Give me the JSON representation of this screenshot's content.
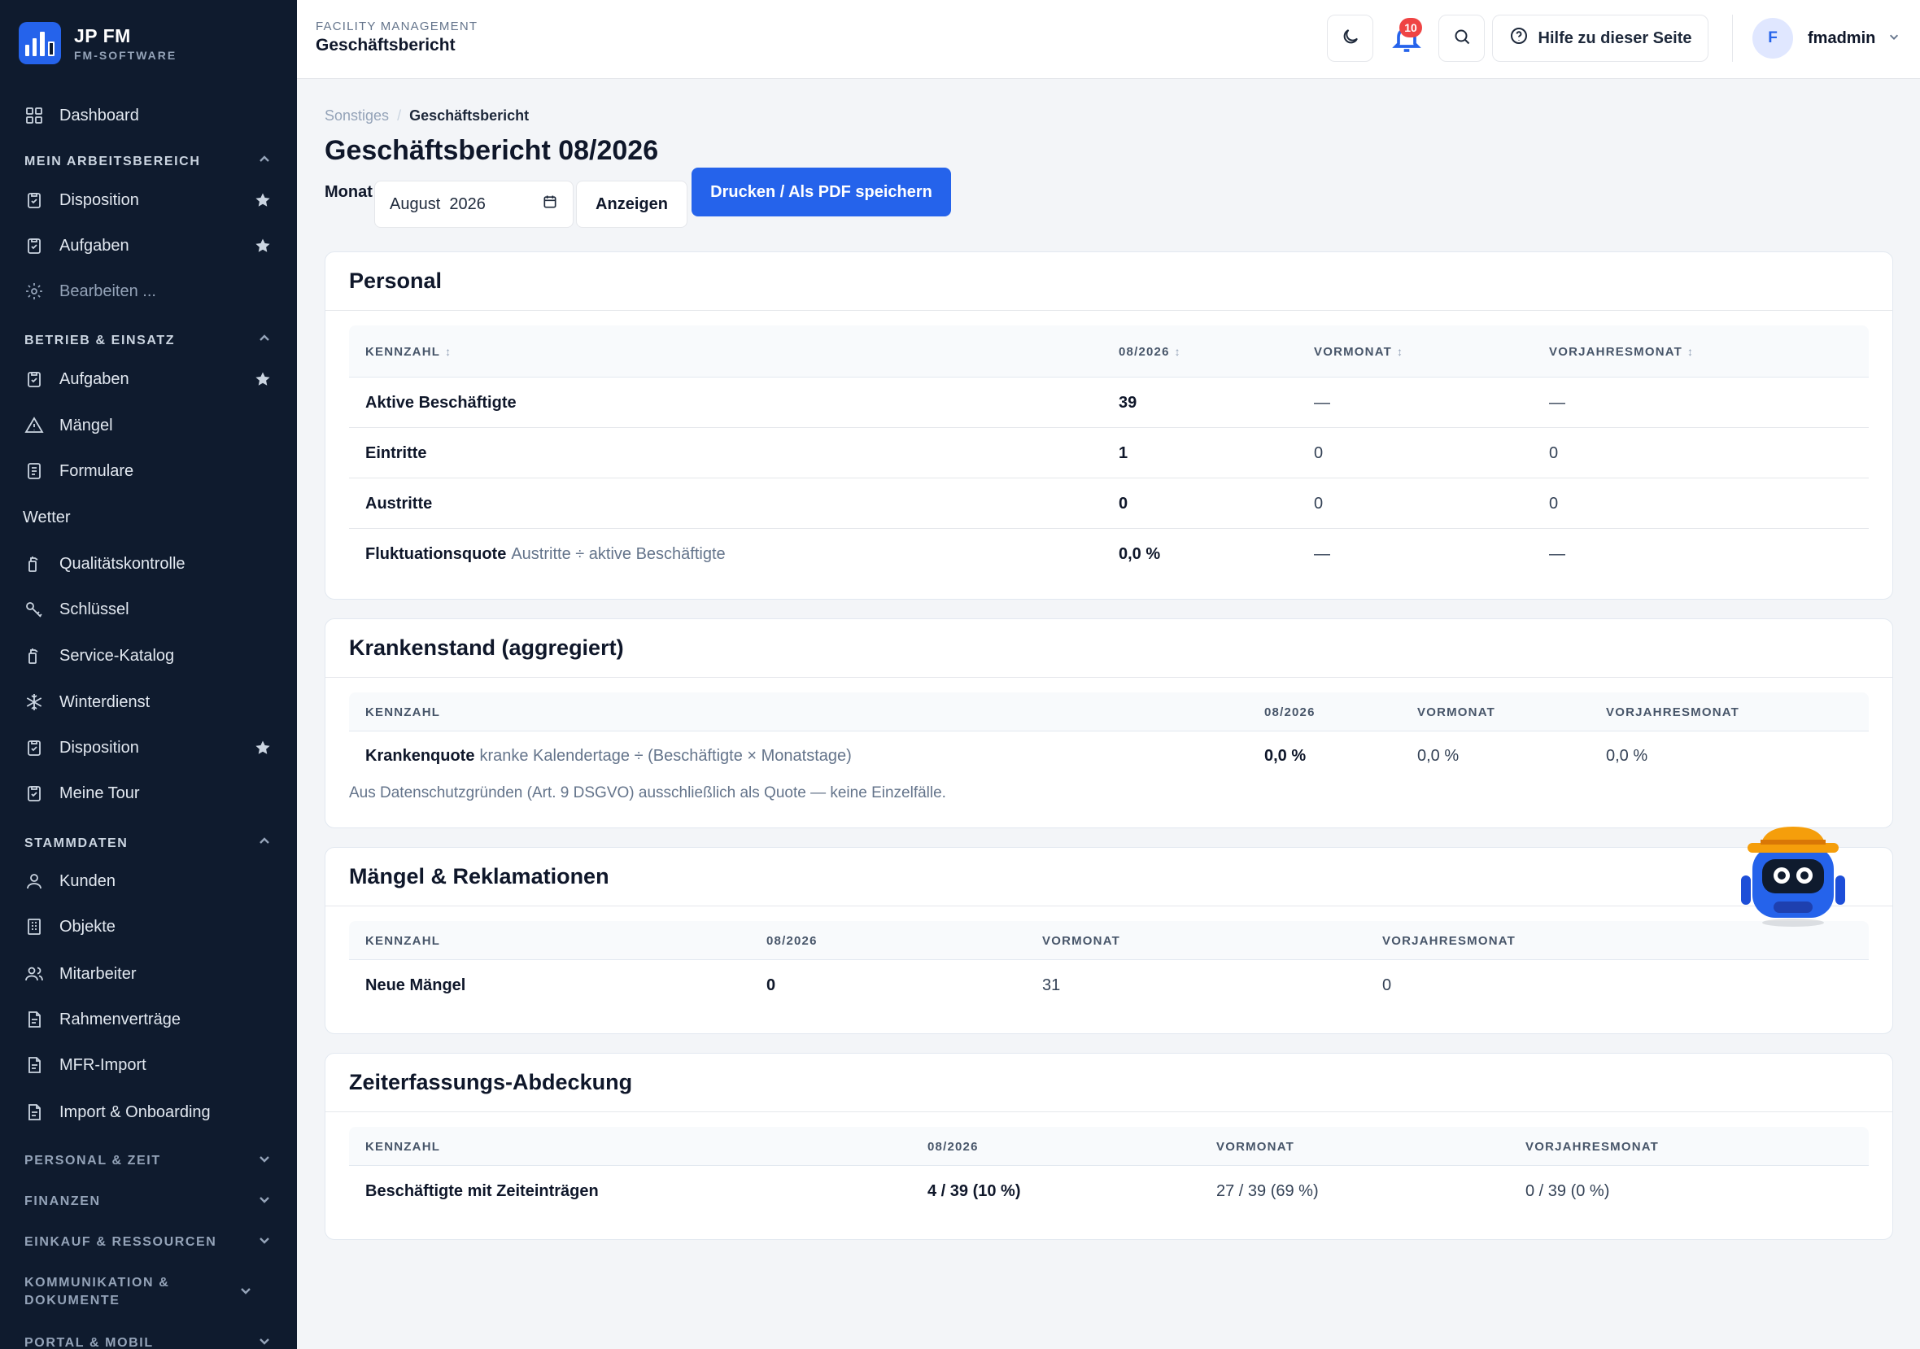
{
  "brand": {
    "title": "JP FM",
    "subtitle": "FM-SOFTWARE"
  },
  "sidebar": {
    "dashboard": "Dashboard",
    "sections": {
      "work": "MEIN ARBEITSBEREICH",
      "ops": "BETRIEB & EINSATZ",
      "master": "STAMMDATEN",
      "personal": "PERSONAL & ZEIT",
      "finance": "FINANZEN",
      "purchase": "EINKAUF & RESSOURCEN",
      "comm": "KOMMUNIKATION & DOKUMENTE",
      "portal": "PORTAL & MOBIL"
    },
    "work_items": [
      "Disposition",
      "Aufgaben",
      "Bearbeiten ..."
    ],
    "ops_items": [
      "Aufgaben",
      "Mängel",
      "Formulare",
      "Wetter",
      "Qualitätskontrolle",
      "Schlüssel",
      "Service-Katalog",
      "Winterdienst",
      "Disposition",
      "Meine Tour"
    ],
    "master_items": [
      "Kunden",
      "Objekte",
      "Mitarbeiter",
      "Rahmenverträge",
      "MFR-Import",
      "Import & Onboarding"
    ]
  },
  "topbar": {
    "kicker": "FACILITY MANAGEMENT",
    "title": "Geschäftsbericht",
    "notifications": "10",
    "help": "Hilfe zu dieser Seite",
    "avatar": "F",
    "username": "fmadmin"
  },
  "breadcrumb": {
    "parent": "Sonstiges",
    "current": "Geschäftsbericht"
  },
  "page": {
    "title": "Geschäftsbericht 08/2026",
    "month_label": "Monat",
    "month_value": "August  2026",
    "show_button": "Anzeigen",
    "print_button": "Drucken / Als PDF speichern"
  },
  "cols": {
    "key": "KENNZAHL",
    "current": "08/2026",
    "prev": "VORMONAT",
    "prev_year": "VORJAHRESMONAT"
  },
  "personal": {
    "title": "Personal",
    "rows": [
      {
        "key": "Aktive Beschäftigte",
        "hint": "",
        "current": "39",
        "prev": "—",
        "prev_year": "—"
      },
      {
        "key": "Eintritte",
        "hint": "",
        "current": "1",
        "prev": "0",
        "prev_year": "0"
      },
      {
        "key": "Austritte",
        "hint": "",
        "current": "0",
        "prev": "0",
        "prev_year": "0"
      },
      {
        "key": "Fluktuationsquote",
        "hint": "Austritte ÷ aktive Beschäftigte",
        "current": "0,0 %",
        "prev": "—",
        "prev_year": "—"
      }
    ]
  },
  "sick": {
    "title": "Krankenstand (aggregiert)",
    "row": {
      "key": "Krankenquote",
      "hint": "kranke Kalendertage ÷ (Beschäftigte × Monatstage)",
      "current": "0,0 %",
      "prev": "0,0 %",
      "prev_year": "0,0 %"
    },
    "note": "Aus Datenschutzgründen (Art. 9 DSGVO) ausschließlich als Quote — keine Einzelfälle."
  },
  "defects": {
    "title": "Mängel & Reklamationen",
    "row": {
      "key": "Neue Mängel",
      "current": "0",
      "prev": "31",
      "prev_year": "0"
    }
  },
  "time": {
    "title": "Zeiterfassungs-Abdeckung",
    "row": {
      "key": "Beschäftigte mit Zeiteinträgen",
      "current": "4 / 39 (10 %)",
      "prev": "27 / 39 (69 %)",
      "prev_year": "0 / 39 (0 %)"
    }
  },
  "colors": {
    "sidebar": "#0f1b2e",
    "accent": "#2563eb",
    "badge": "#ef4444"
  }
}
